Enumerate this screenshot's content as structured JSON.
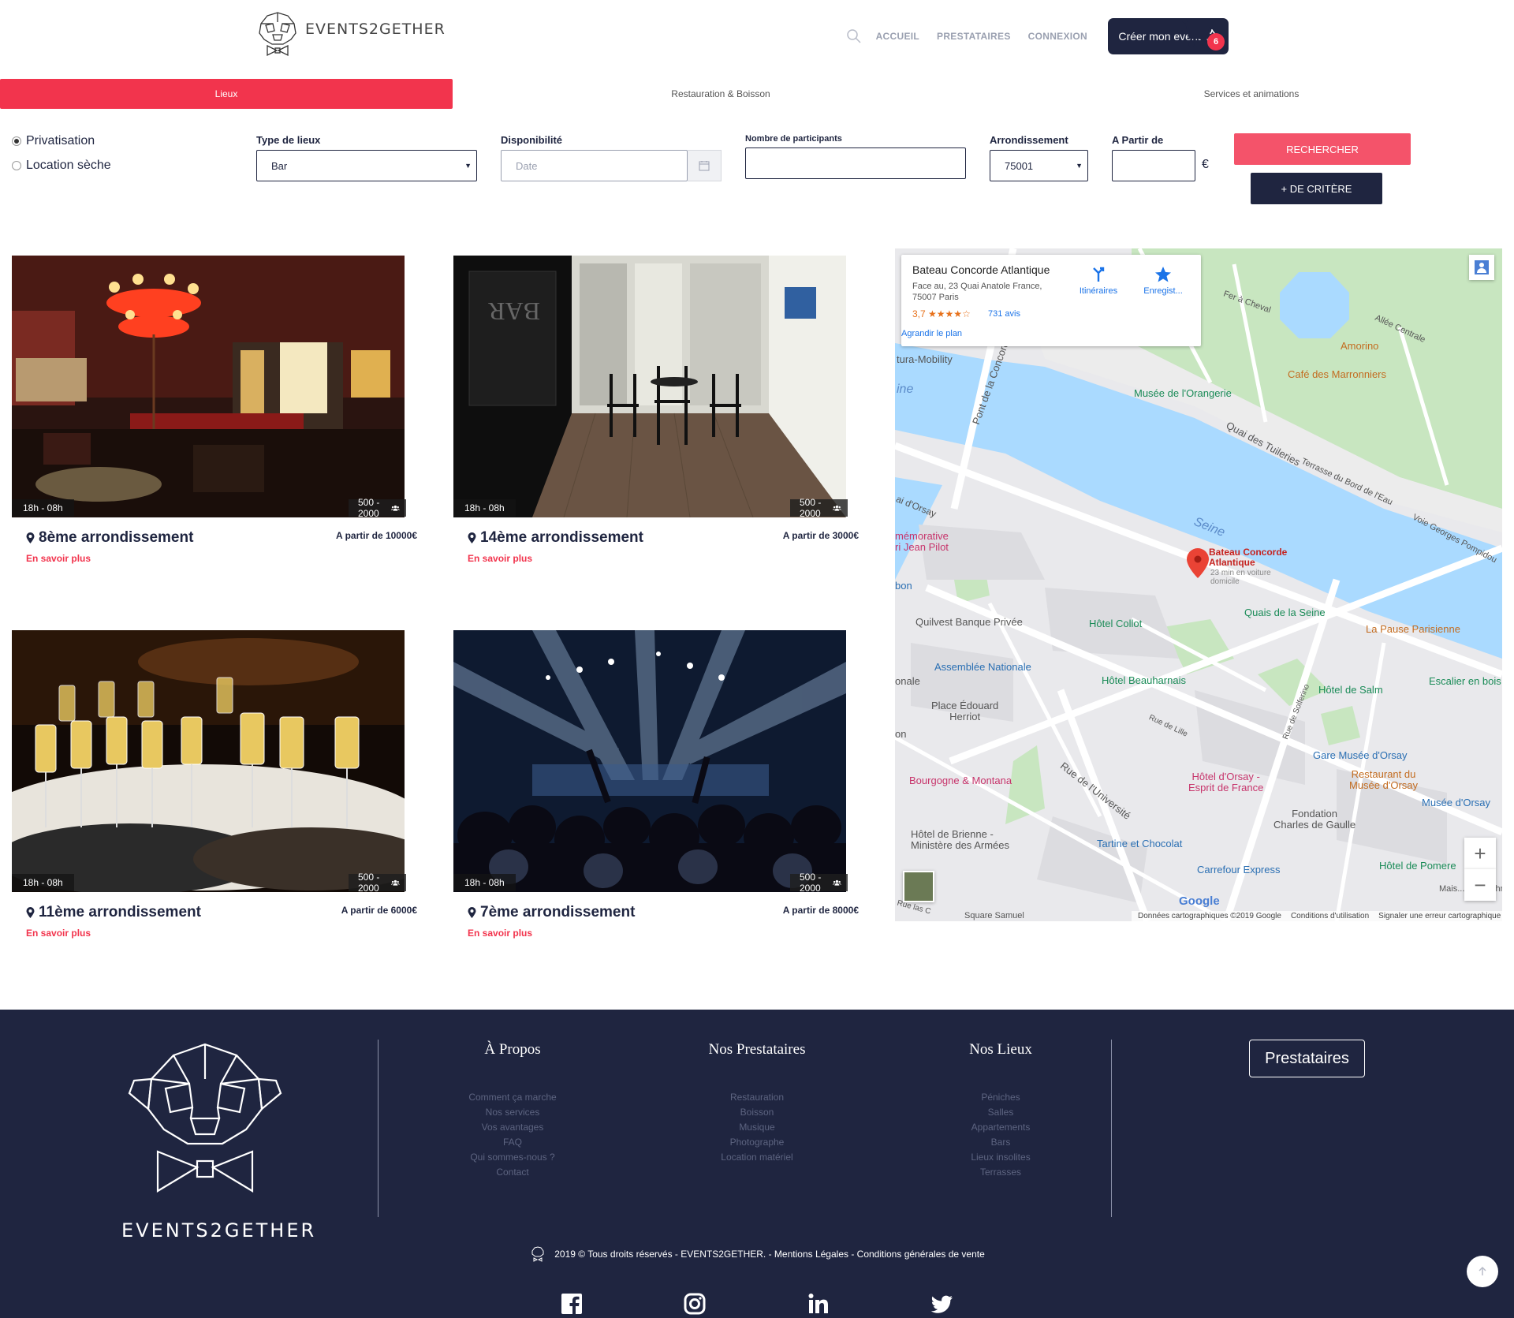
{
  "header": {
    "logo_text": "EVENTS2GETHER",
    "nav": [
      "ACCUEIL",
      "PRESTATAIRES",
      "CONNEXION"
    ],
    "create_button": "Créer mon event",
    "cart_count": "6"
  },
  "tabs": [
    "Lieux",
    "Restauration & Boisson",
    "Services et animations"
  ],
  "form": {
    "radio_1": "Privatisation",
    "radio_2": "Location sèche",
    "type_label": "Type de lieux",
    "type_value": "Bar",
    "dispo_label": "Disponibilité",
    "dispo_placeholder": "Date",
    "participants_label": "Nombre de participants",
    "arr_label": "Arrondissement",
    "arr_value": "75001",
    "from_label": "A Partir de",
    "currency": "€",
    "search_button": "RECHERCHER",
    "more_button": "+ DE CRITÈRE"
  },
  "cards": [
    {
      "hours": "18h - 08h",
      "capacity": "500 - 2000",
      "title": "8ème arrondissement",
      "price": "A partir de 10000€",
      "more": "En savoir plus"
    },
    {
      "hours": "18h - 08h",
      "capacity": "500 - 2000",
      "title": "14ème arrondissement",
      "price": "A partir de 3000€",
      "more": "En savoir plus"
    },
    {
      "hours": "18h - 08h",
      "capacity": "500 - 2000",
      "title": "11ème arrondissement",
      "price": "A partir de 6000€",
      "more": "En savoir plus"
    },
    {
      "hours": "18h - 08h",
      "capacity": "500 - 2000",
      "title": "7ème arrondissement",
      "price": "A partir de 8000€",
      "more": "En savoir plus"
    }
  ],
  "map": {
    "info_title": "Bateau Concorde Atlantique",
    "info_address_1": "Face au, 23 Quai Anatole France,",
    "info_address_2": "75007 Paris",
    "info_rating": "3,7",
    "info_stars": "★★★★☆",
    "info_reviews": "731 avis",
    "info_link": "Agrandir le plan",
    "itinerary": "Itinéraires",
    "save": "Enregist...",
    "labels": {
      "pont": "Pont de la Concorde",
      "quai_tuileries": "Quai des Tuileries",
      "seine": "Seine",
      "seine_left": "ine",
      "orangerie": "Musée de l'Orangerie",
      "amorino": "Amorino",
      "marronniers": "Café des Marronniers",
      "fer_cheval": "Fer à Cheval",
      "allee_centrale": "Allée Centrale",
      "terrasse": "Terrasse du Bord de l'Eau",
      "voie_pompidou": "Voie Georges Pompidou",
      "mobility": "tura-Mobility",
      "concorde_1": "Bateau Concorde",
      "concorde_2": "Atlantique",
      "concorde_sub_1": "23 min en voiture",
      "concorde_sub_2": "domicile",
      "quilvest": "Quilvest Banque Privée",
      "hotel_collot": "Hôtel Collot",
      "quais_seine": "Quais de la Seine",
      "pause": "La Pause Parisienne",
      "assemblee": "Assemblée Nationale",
      "beauharnais": "Hôtel Beauharnais",
      "salm": "Hôtel de Salm",
      "escalier": "Escalier en bois",
      "place_herriot_1": "Place Édouard",
      "place_herriot_2": "Herriot",
      "rue_lille": "Rue de Lille",
      "gare_orsay": "Gare Musée d'Orsay",
      "bourgogne": "Bourgogne & Montana",
      "hotel_orsay_1": "Hôtel d'Orsay -",
      "hotel_orsay_2": "Esprit de France",
      "restaurant_orsay_1": "Restaurant du",
      "restaurant_orsay_2": "Musée d'Orsay",
      "musee_orsay": "Musée d'Orsay",
      "universite": "Rue de l'Université",
      "fondation_1": "Fondation",
      "fondation_2": "Charles de Gaulle",
      "brienne_1": "Hôtel de Brienne -",
      "brienne_2": "Ministère des Armées",
      "tartine": "Tartine et Chocolat",
      "carrefour": "Carrefour Express",
      "pomereu": "Hôtel de Pomere",
      "polytech": "Mais... Polytechnic",
      "jean_pilot_1": "mémorative",
      "jean_pilot_2": "ri Jean Pilot",
      "orsay_left": "ai d'Orsay",
      "bon": "bon",
      "onale": "onale",
      "on": "on",
      "square": "Square Samuel",
      "rue_las": "Rue las C",
      "solferino": "Rue de Solferino"
    },
    "google": "Google",
    "footer": [
      "Données cartographiques ©2019 Google",
      "Conditions d'utilisation",
      "Signaler une erreur cartographique"
    ]
  },
  "footer": {
    "logo_text": "EVENTS2GETHER",
    "col1_title": "À Propos",
    "col1_links": [
      "Comment ça marche",
      "Nos services",
      "Vos avantages",
      "FAQ",
      "Qui sommes-nous ?",
      "Contact"
    ],
    "col2_title": "Nos Prestataires",
    "col2_links": [
      "Restauration",
      "Boisson",
      "Musique",
      "Photographe",
      "Location matériel"
    ],
    "col3_title": "Nos Lieux",
    "col3_links": [
      "Péniches",
      "Salles",
      "Appartements",
      "Bars",
      "Lieux insolites",
      "Terrasses"
    ],
    "prest_button": "Prestataires",
    "copyright": "2019 © Tous droits réservés - EVENTS2GETHER. - Mentions Légales - Conditions générales de vente"
  },
  "colors": {
    "accent": "#f2344d",
    "navy": "#1f2540",
    "map_water": "#aadaff",
    "map_park": "#c8e6c0"
  }
}
